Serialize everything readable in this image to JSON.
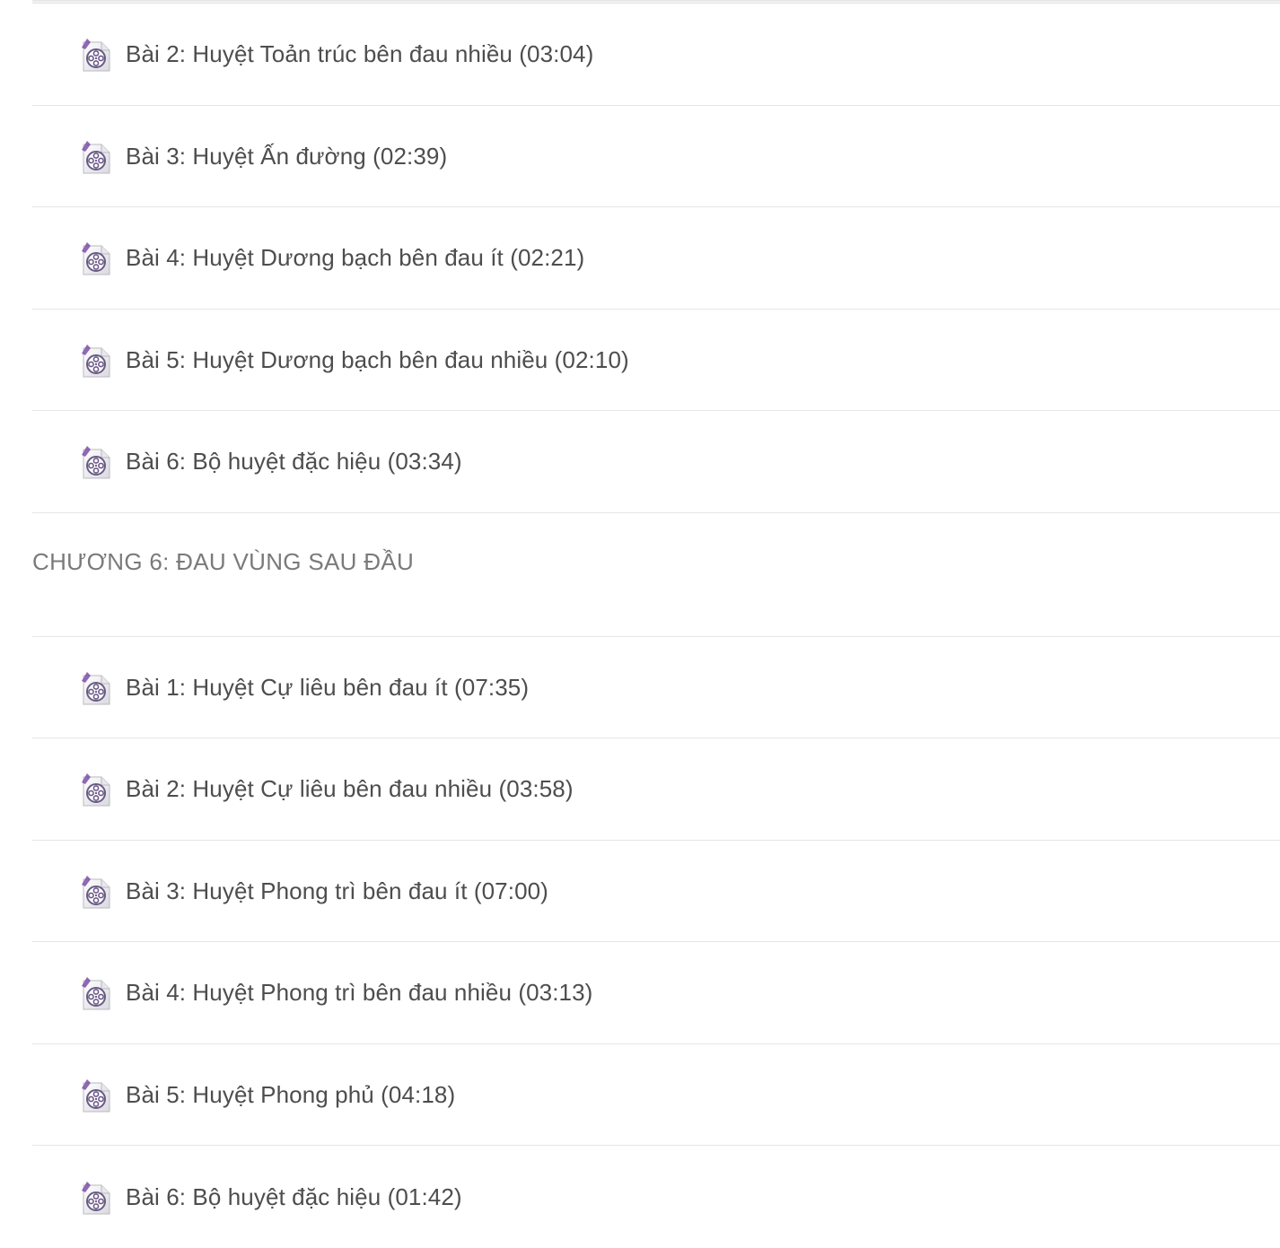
{
  "sections": [
    {
      "chapter": null,
      "lessons": [
        {
          "title": "Bài 2: Huyệt Toản trúc bên đau nhiều (03:04)",
          "icon": "video-file-icon"
        },
        {
          "title": "Bài 3: Huyệt Ấn đường (02:39)",
          "icon": "video-file-icon"
        },
        {
          "title": "Bài 4: Huyệt Dương bạch bên đau ít (02:21)",
          "icon": "video-file-icon"
        },
        {
          "title": "Bài 5: Huyệt Dương bạch bên đau nhiều (02:10)",
          "icon": "video-file-icon"
        },
        {
          "title": "Bài 6: Bộ huyệt đặc hiệu (03:34)",
          "icon": "video-file-icon"
        }
      ]
    },
    {
      "chapter": "CHƯƠNG 6: ĐAU VÙNG SAU ĐẦU",
      "lessons": [
        {
          "title": "Bài 1: Huyệt Cự liêu bên đau ít (07:35)",
          "icon": "video-file-icon"
        },
        {
          "title": "Bài 2: Huyệt Cự liêu bên đau nhiều (03:58)",
          "icon": "video-file-icon"
        },
        {
          "title": "Bài 3: Huyệt Phong trì bên đau ít (07:00)",
          "icon": "video-file-icon"
        },
        {
          "title": "Bài 4: Huyệt Phong trì bên đau nhiều (03:13)",
          "icon": "video-file-icon"
        },
        {
          "title": "Bài 5: Huyệt Phong phủ (04:18)",
          "icon": "video-file-icon"
        },
        {
          "title": "Bài 6: Bộ huyệt đặc hiệu (01:42)",
          "icon": "video-file-icon"
        }
      ]
    }
  ],
  "colors": {
    "text": "#4d4d4d",
    "chapter_text": "#7a7a7a",
    "divider": "#e6e6e6",
    "icon_accent": "#7b4fa8"
  }
}
